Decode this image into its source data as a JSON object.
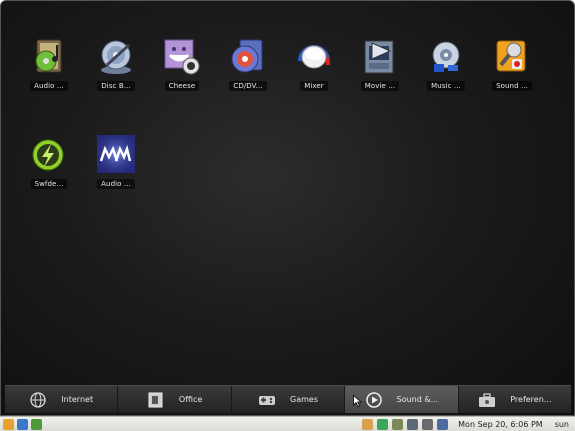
{
  "apps": [
    {
      "label": "Audio ...",
      "icon": "audio-cd-icon"
    },
    {
      "label": "Disc B...",
      "icon": "disc-burner-icon"
    },
    {
      "label": "Cheese",
      "icon": "webcam-icon"
    },
    {
      "label": "CD/DV...",
      "icon": "cd-dvd-creator-icon"
    },
    {
      "label": "Mixer",
      "icon": "mixer-knob-icon"
    },
    {
      "label": "Movie ...",
      "icon": "movie-player-icon"
    },
    {
      "label": "Music ...",
      "icon": "music-player-icon"
    },
    {
      "label": "Sound ...",
      "icon": "sound-recorder-icon"
    },
    {
      "label": "Swfde...",
      "icon": "swf-lightning-icon"
    },
    {
      "label": "Audio ...",
      "icon": "audio-mmx-icon"
    }
  ],
  "tabs": [
    {
      "label": "Internet",
      "icon": "globe-icon"
    },
    {
      "label": "Office",
      "icon": "document-icon"
    },
    {
      "label": "Games",
      "icon": "gamepad-icon"
    },
    {
      "label": "Sound &...",
      "icon": "play-circle-icon",
      "active": true
    },
    {
      "label": "Preferen...",
      "icon": "toolbox-icon"
    }
  ],
  "panel": {
    "clock": "Mon Sep 20,  6:06 PM",
    "user": "sun"
  },
  "colors": {
    "background": "#1b1b1b",
    "label_bg": "#000000",
    "tab_active": "#555555",
    "panel_bg": "#e6e6e1"
  }
}
